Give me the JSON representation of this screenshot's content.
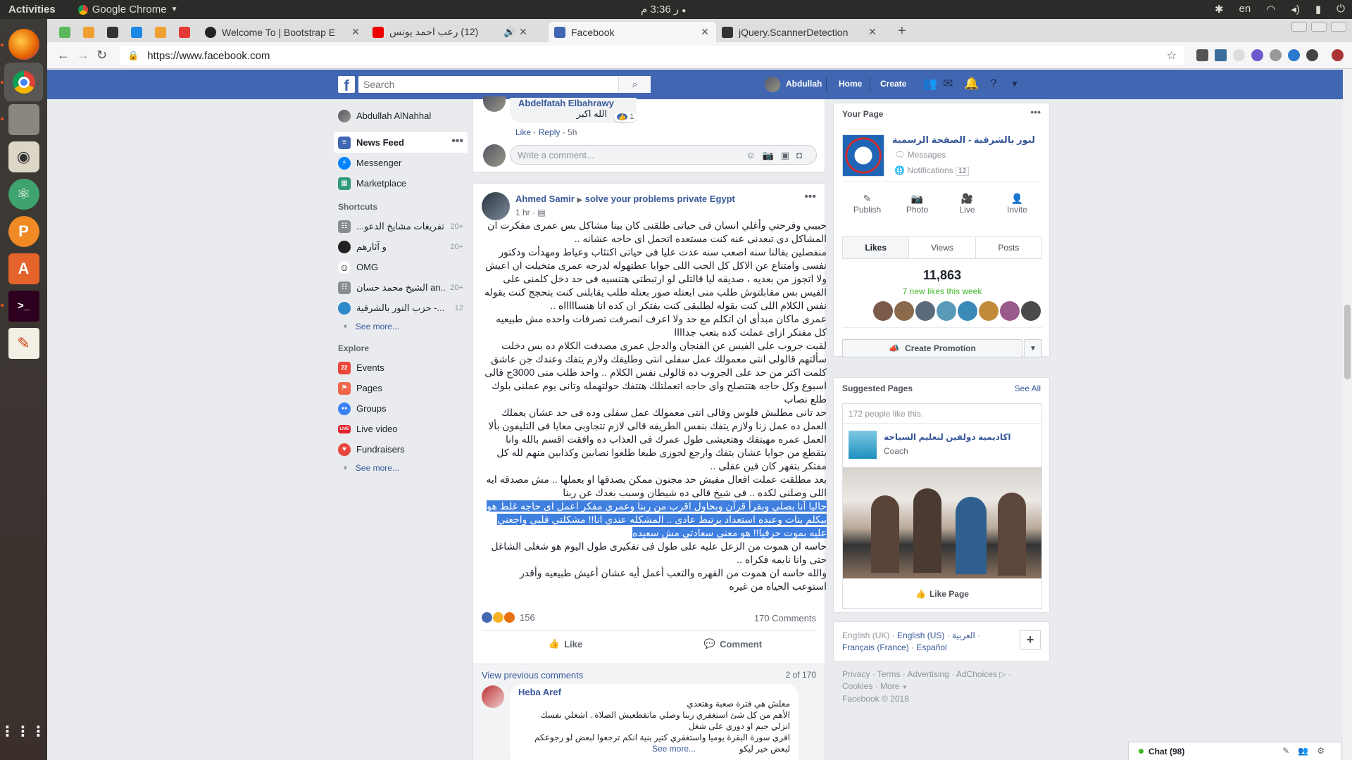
{
  "desktop": {
    "activities": "Activities",
    "app_name": "Google Chrome",
    "clock": "3:36 م",
    "ampm_suffix": "ر",
    "lang": "en"
  },
  "browser": {
    "tabs": [
      {
        "title": "Welcome To | Bootstrap E",
        "favicon_color": "#222"
      },
      {
        "title": "(12) رعب احمد يونس",
        "favicon_color": "#e00"
      },
      {
        "title": "Facebook",
        "favicon_color": "#4267b2"
      },
      {
        "title": "jQuery.ScannerDetection",
        "favicon_color": "#333"
      }
    ],
    "url": "https://www.facebook.com"
  },
  "fb": {
    "search_placeholder": "Search",
    "user": "Abdullah",
    "nav_home": "Home",
    "nav_create": "Create",
    "brand_color": "#4267b2"
  },
  "leftnav": {
    "profile": "Abdullah AlNahhal",
    "main": [
      {
        "label": "News Feed",
        "color": "#4267b2"
      },
      {
        "label": "Messenger",
        "color": "#0084ff"
      },
      {
        "label": "Marketplace",
        "color": "#2f9b7a"
      }
    ],
    "shortcuts_title": "Shortcuts",
    "shortcuts": [
      {
        "label": "تفريغات مشايخ الدعو...",
        "count": "20+"
      },
      {
        "label": "و آثارهم",
        "count": "20+"
      },
      {
        "label": "OMG",
        "count": ""
      },
      {
        "label": "الشيخ محمد حسان an..",
        "count": "20+"
      },
      {
        "label": "حزب النور بالشرقية -...",
        "count": "12"
      }
    ],
    "see_more": "See more...",
    "explore_title": "Explore",
    "explore": [
      {
        "label": "Events",
        "color": "#e9473b",
        "glyph": "22"
      },
      {
        "label": "Pages",
        "color": "#f0664a",
        "glyph": "⚑"
      },
      {
        "label": "Groups",
        "color": "#3b82f6",
        "glyph": "●●"
      },
      {
        "label": "Live video",
        "color": "#e4222e",
        "glyph": "LIVE"
      },
      {
        "label": "Fundraisers",
        "color": "#e9473b",
        "glyph": "♥"
      }
    ]
  },
  "prev_comment": {
    "author": "Abdelfatah Elbahrawy",
    "text": "الله اكبر",
    "likes": "1",
    "like": "Like",
    "reply": "Reply",
    "time": "5h",
    "write_placeholder": "Write a comment..."
  },
  "post": {
    "author": "Ahmed Samir",
    "group": "solve your problems private Egypt",
    "time": "1 hr",
    "paragraphs": [
      "حبيبي وفرحتي وأغلي انسان فى حياتى طلقنى كان بينا مشاكل بس عمرى مفكرت ان المشاكل دى تبعدنى عنه كنت مستعده اتحمل اى حاجه عشانه ..",
      "منفصلين بقالنا سنه اصعب سنه عدت عليا فى حياتى اكتئاب وعياط ومهدأت ودكتور نفسى وامتناع عن الاكل كل الحب اللى جوايا عطتهوله لدرجه عمرى متخيلت ان اعيش ولا اتجوز من بعديه ، صديقه ليا قالتلى لو ارتبطتى هتنسيه فى حد دخل كلمنى على الفيس بس مقابلتوش طلب منى ابعتله صور بعتله طلب يقابلنى كنت بتحجج كنت بقوله نفس الكلام اللى كنت بقوله لطليقى كنت بفتكر ان كده انا هنساااااه ..",
      "عمرى ماكان مبدأى ان اتكلم مع حد ولا اعرف انصرفت تصرفات واحده مش طبيعيه كل مفتكر ازاى عملت كده بتعب جداااا",
      "لقيت جروب على الفيس عن الفنجان والدجل عمرى مصدقت الكلام ده بس دخلت سألتهم قالولى انتى معمولك عمل سفلى انتى وطليقك ولازم يتفك وعندك جن عاشق كلمت اكتر من حد على الجروب ده قالولى نفس الكلام .. واحد طلب منى 3000ج قالى اسبوع وكل حاجه هتتصلح واى حاجه اتعملتلك هتتفك حولتهمله وتانى يوم عملنى بلوك طلع نصاب",
      "حد تانى مطلبش فلوس وقالى انتى معمولك عمل سفلى وده فى حد عشان يعملك العمل ده عمل زنا ولازم يتفك بنفس الطريقه قالى لازم تتجاوبى معايا فى التليفون بألا العمل عمره مهيتفك وهتعيشى طول عمرك فى العذاب ده وافقت اقسم بالله وانا بتقطع من جوايا عشان يتفك وارجع لجوزى طبعا طلعوا نصابين وكذابين منهم لله كل مفتكر بتقهر كان فين عقلى ..",
      "بعد مطلقت عملت افعال مفيش حد مجنون ممكن يصدقها او يعملها .. مش مصدقه ايه اللى وصلنى لكده .. فى شيخ قالى ده شيطان وسبب بعدك عن ربنا"
    ],
    "selected_paragraph": "حاليا أنا بصلي وبقرأ قرآن وبحاول اقرب من ربنا وعمري مفكر اعمل اى حاجه غلط هو بيكلم بنات وعنده استعداد يرتبط عادى .. المشكله عندي انا!! مشكلتي قلبي واجعني عليه بموت حرفيا!! هو معني سعادتي مش سعيده",
    "tail_paragraphs": [
      "حاسه ان هموت من الزعل عليه على طول فى تفكيرى طول اليوم هو شغلى الشاغل حتى وانا نايمه فكراه ..",
      "والله حاسه ان هموت من القهره والتعب أعمل أيه عشان أعيش طبيعيه وأقدر استوعب الحياه من غيره"
    ],
    "reactions_count": "156",
    "comments_count": "170 Comments",
    "like_label": "Like",
    "comment_label": "Comment",
    "view_previous": "View previous comments",
    "comment_paging": "2 of 170"
  },
  "comment": {
    "author": "Heba Aref",
    "lines": [
      "معلش هي فترة صعبة وهتعدي",
      "الأهم من كل شئ استغفري ربنا وصلي ماتقطعيش الصلاة . اشغلي نفسك",
      "انزلي جيم او دوري على شغل",
      "اقري سورة البقرة يوميا واستغفري كتير بنية انكم ترجعوا لبعض لو رجوعكم",
      "لبعض خير ليكو"
    ],
    "see_more": "See more..."
  },
  "right": {
    "your_page": "Your Page",
    "page_name": "لنور بالشرقية - الصفحة الرسمية",
    "messages": "Messages",
    "notifications": "Notifications",
    "notif_count": "12",
    "actions": [
      "Publish",
      "Photo",
      "Live",
      "Invite"
    ],
    "stat_tabs": [
      "Likes",
      "Views",
      "Posts"
    ],
    "likes_total": "11,863",
    "likes_week": "7 new likes this week",
    "create_promotion": "Create Promotion",
    "suggested_title": "Suggested Pages",
    "see_all": "See All",
    "people_like": "172 people like this.",
    "sugg_name": "اكاديمية دولفين لتعليم السباحة",
    "sugg_cat": "Coach",
    "like_page": "Like Page",
    "languages": [
      "English (UK)",
      "English (US)",
      "العربية",
      "Français (France)",
      "Español"
    ],
    "footer_links": [
      "Privacy",
      "Terms",
      "Advertising",
      "AdChoices",
      "Cookies",
      "More"
    ],
    "copyright": "Facebook © 2018"
  },
  "chat": {
    "label": "Chat (98)"
  }
}
